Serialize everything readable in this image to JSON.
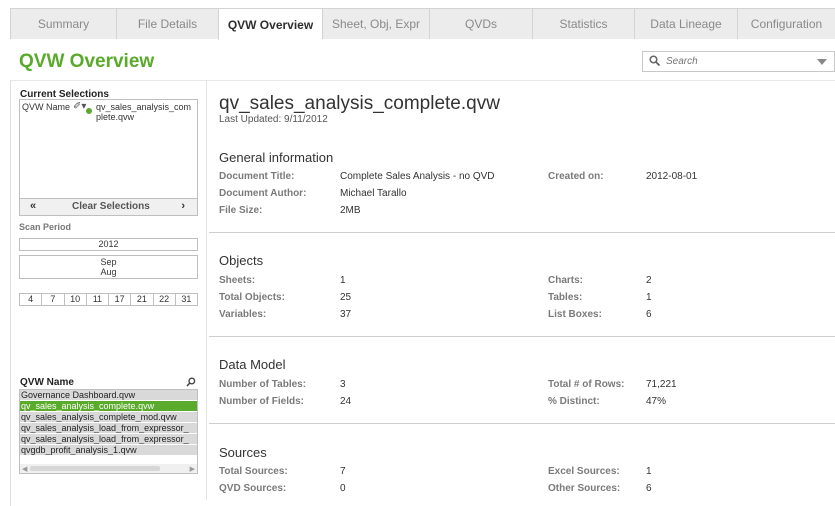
{
  "tabs": [
    "Summary",
    "File Details",
    "QVW Overview",
    "Sheet, Obj, Expr",
    "QVDs",
    "Statistics",
    "Data Lineage",
    "Configuration"
  ],
  "active_tab": "QVW Overview",
  "header": {
    "title": "QVW Overview",
    "search_placeholder": "Search"
  },
  "current_selections": {
    "title": "Current Selections",
    "field": "QVW Name",
    "value": "qv_sales_analysis_complete.qvw",
    "clear_label": "Clear Selections"
  },
  "scan_period": {
    "title": "Scan Period",
    "year": "2012",
    "months": [
      "Sep",
      "Aug"
    ],
    "days": [
      "4",
      "7",
      "10",
      "11",
      "17",
      "21",
      "22",
      "31"
    ]
  },
  "qvw_list": {
    "title": "QVW Name",
    "items": [
      "Governance Dashboard.qvw",
      "qv_sales_analysis_complete.qvw",
      "qv_sales_analysis_complete_mod.qvw",
      "qv_sales_analysis_load_from_expressor_",
      "qv_sales_analysis_load_from_expressor_",
      "qvgdb_profit_analysis_1.qvw"
    ],
    "selected_index": 1
  },
  "document": {
    "title": "qv_sales_analysis_complete.qvw",
    "last_updated": "Last Updated: 9/11/2012"
  },
  "general": {
    "heading": "General information",
    "title_label": "Document Title:",
    "title_value": "Complete Sales Analysis - no QVD",
    "author_label": "Document Author:",
    "author_value": "Michael Tarallo",
    "size_label": "File Size:",
    "size_value": "2MB",
    "created_label": "Created on:",
    "created_value": "2012-08-01"
  },
  "objects": {
    "heading": "Objects",
    "sheets_label": "Sheets:",
    "sheets_value": "1",
    "total_label": "Total Objects:",
    "total_value": "25",
    "vars_label": "Variables:",
    "vars_value": "37",
    "charts_label": "Charts:",
    "charts_value": "2",
    "tables_label": "Tables:",
    "tables_value": "1",
    "lb_label": "List Boxes:",
    "lb_value": "6"
  },
  "data_model": {
    "heading": "Data Model",
    "ntables_label": "Number of Tables:",
    "ntables_value": "3",
    "nfields_label": "Number of Fields:",
    "nfields_value": "24",
    "rows_label": "Total # of Rows:",
    "rows_value": "71,221",
    "distinct_label": "% Distinct:",
    "distinct_value": "47%"
  },
  "sources": {
    "heading": "Sources",
    "total_label": "Total Sources:",
    "total_value": "7",
    "qvd_label": "QVD Sources:",
    "qvd_value": "0",
    "excel_label": "Excel Sources:",
    "excel_value": "1",
    "other_label": "Other Sources:",
    "other_value": "6"
  },
  "colors": {
    "accent": "#5aaa2b",
    "tab_bg": "#ececec"
  }
}
